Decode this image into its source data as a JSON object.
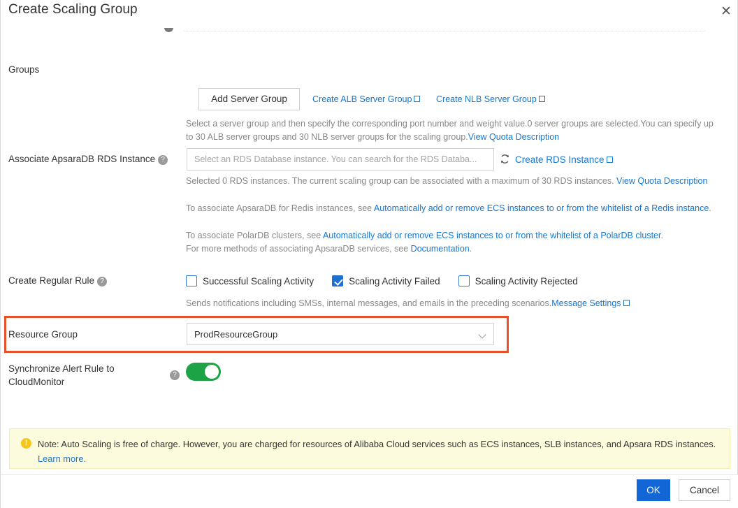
{
  "dialog": {
    "title": "Create Scaling Group",
    "close_icon": "close-icon"
  },
  "form": {
    "groups": {
      "label": "Groups",
      "add_server_group_button": "Add Server Group",
      "create_alb_link": "Create ALB Server Group",
      "create_nlb_link": "Create NLB Server Group",
      "hint_part1": "Select a server group and then specify the corresponding port number and weight value.0 server groups are selected.You can specify up to 30 ALB server groups and 30 NLB server groups for the scaling group.",
      "hint_link": "View Quota Description"
    },
    "rds": {
      "label": "Associate ApsaraDB RDS Instance",
      "input_placeholder": "Select an RDS Database instance. You can search for the RDS Databa...",
      "input_value": "",
      "refresh_icon": "refresh-icon",
      "create_rds_link": "Create RDS Instance",
      "hint_line1_text": "Selected 0 RDS instances. The current scaling group can be associated with a maximum of 30 RDS instances. ",
      "hint_line1_link": "View Quota Description",
      "hint_line2_pre": "To associate ApsaraDB for Redis instances, see ",
      "hint_line2_link": "Automatically add or remove ECS instances to or from the whitelist of a Redis instance",
      "hint_line2_post": ".",
      "hint_line3_pre": "To associate PolarDB clusters, see ",
      "hint_line3_link": "Automatically add or remove ECS instances to or from the whitelist of a PolarDB cluster",
      "hint_line3_post": ".",
      "hint_line4_pre": "For more methods of associating ApsaraDB services, see ",
      "hint_line4_link": "Documentation",
      "hint_line4_post": "."
    },
    "regular_rule": {
      "label": "Create Regular Rule",
      "checkboxes": [
        {
          "label": "Successful Scaling Activity",
          "checked": false
        },
        {
          "label": "Scaling Activity Failed",
          "checked": true
        },
        {
          "label": "Scaling Activity Rejected",
          "checked": false
        }
      ],
      "hint_text": "Sends notifications including SMSs, internal messages, and emails in the preceding scenarios.",
      "hint_link": "Message Settings"
    },
    "resource_group": {
      "label": "Resource Group",
      "selected_value": "ProdResourceGroup",
      "highlight_color": "#e8502a"
    },
    "sync_alert": {
      "label": "Synchronize Alert Rule to CloudMonitor",
      "toggle_on": true,
      "toggle_color": "#1ba345"
    }
  },
  "notice": {
    "icon": "warning-icon",
    "text": "Note: Auto Scaling is free of charge. However, you are charged for resources of Alibaba Cloud services such as ECS instances, SLB instances, and Apsara RDS instances.",
    "link": "Learn more."
  },
  "footer": {
    "ok_label": "OK",
    "cancel_label": "Cancel",
    "ok_color": "#1366d6"
  }
}
